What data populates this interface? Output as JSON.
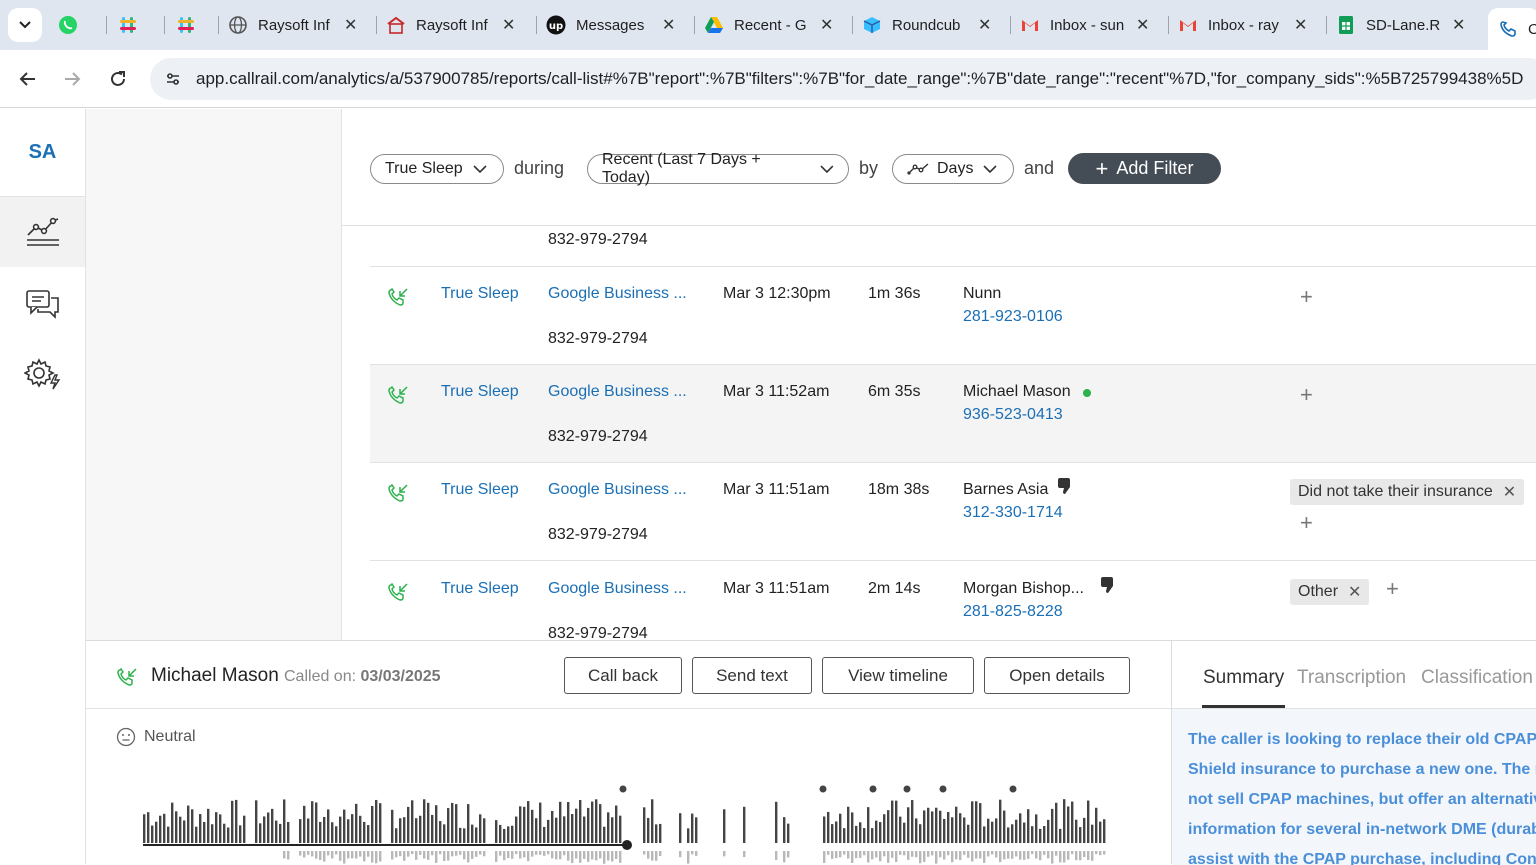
{
  "browser": {
    "tabs": [
      {
        "title": "",
        "icon": "whatsapp-icon",
        "color": "#25d366"
      },
      {
        "title": "",
        "icon": "slack-icon",
        "color": "#e01e5a"
      },
      {
        "title": "",
        "icon": "slack-icon",
        "color": "#e01e5a"
      },
      {
        "title": "Raysoft Inf",
        "icon": "globe-icon",
        "color": "#555555"
      },
      {
        "title": "Raysoft Inf",
        "icon": "raysoft-icon",
        "color": "#c62828"
      },
      {
        "title": "Messages",
        "icon": "upwork-icon",
        "color": "#111111"
      },
      {
        "title": "Recent - G",
        "icon": "google-drive-icon",
        "color": "#1a73e8"
      },
      {
        "title": "Roundcub",
        "icon": "roundcube-icon",
        "color": "#37beff"
      },
      {
        "title": "Inbox - sun",
        "icon": "gmail-icon",
        "color": "#ea4335"
      },
      {
        "title": "Inbox - ray",
        "icon": "gmail-icon",
        "color": "#ea4335"
      },
      {
        "title": "SD-Lane.R",
        "icon": "sheets-icon",
        "color": "#0f9d58"
      },
      {
        "title": "C",
        "icon": "callrail-icon",
        "color": "#1b6fb5"
      }
    ],
    "url": "app.callrail.com/analytics/a/537900785/reports/call-list#%7B\"report\":%7B\"filters\":%7B\"for_date_range\":%7B\"date_range\":\"recent\"%7D,\"for_company_sids\":%5B725799438%5D"
  },
  "app": {
    "logo": "SA",
    "filters": {
      "company": "True Sleep",
      "during": "during",
      "date_range": "Recent (Last 7 Days + Today)",
      "by": "by",
      "interval": "Days",
      "and": "and",
      "add_filter": "Add Filter"
    },
    "top_partial_tracking": "832-979-2794",
    "calls": [
      {
        "company": "True Sleep",
        "source": "Google Business ...",
        "tracking": "832-979-2794",
        "time": "Mar 3 12:30pm",
        "duration": "1m 36s",
        "name": "Nunn",
        "phone": "281-923-0106",
        "tags": [],
        "status": "none"
      },
      {
        "company": "True Sleep",
        "source": "Google Business ...",
        "tracking": "832-979-2794",
        "time": "Mar 3 11:52am",
        "duration": "6m 35s",
        "name": "Michael Mason",
        "phone": "936-523-0413",
        "tags": [],
        "status": "new"
      },
      {
        "company": "True Sleep",
        "source": "Google Business ...",
        "tracking": "832-979-2794",
        "time": "Mar 3 11:51am",
        "duration": "18m 38s",
        "name": "Barnes Asia",
        "phone": "312-330-1714",
        "tags": [
          "Did not take their insurance"
        ],
        "status": "thumbs-down"
      },
      {
        "company": "True Sleep",
        "source": "Google Business ...",
        "tracking": "832-979-2794",
        "time": "Mar 3 11:51am",
        "duration": "2m 14s",
        "name": "Morgan Bishop...",
        "phone": "281-825-8228",
        "tags": [
          "Other"
        ],
        "status": "thumbs-down"
      }
    ],
    "detail": {
      "caller": "Michael Mason",
      "called_on_label": "Called on:",
      "called_on_date": "03/03/2025",
      "buttons": [
        "Call back",
        "Send text",
        "View timeline",
        "Open details"
      ],
      "sentiment": "Neutral"
    },
    "summary": {
      "tabs": [
        "Summary",
        "Transcription",
        "Classification"
      ],
      "lines": [
        "The caller is looking to replace their old CPAP m",
        "Shield insurance to purchase a new one. The re",
        "not sell CPAP machines, but offer an alternative",
        "information for several in-network DME (durab",
        "assist with the CPAP purchase, including Conc"
      ]
    },
    "colors": {
      "accent": "#1b6fb5",
      "positive": "#2bb24c",
      "summary_text": "#4a8fd8"
    }
  }
}
